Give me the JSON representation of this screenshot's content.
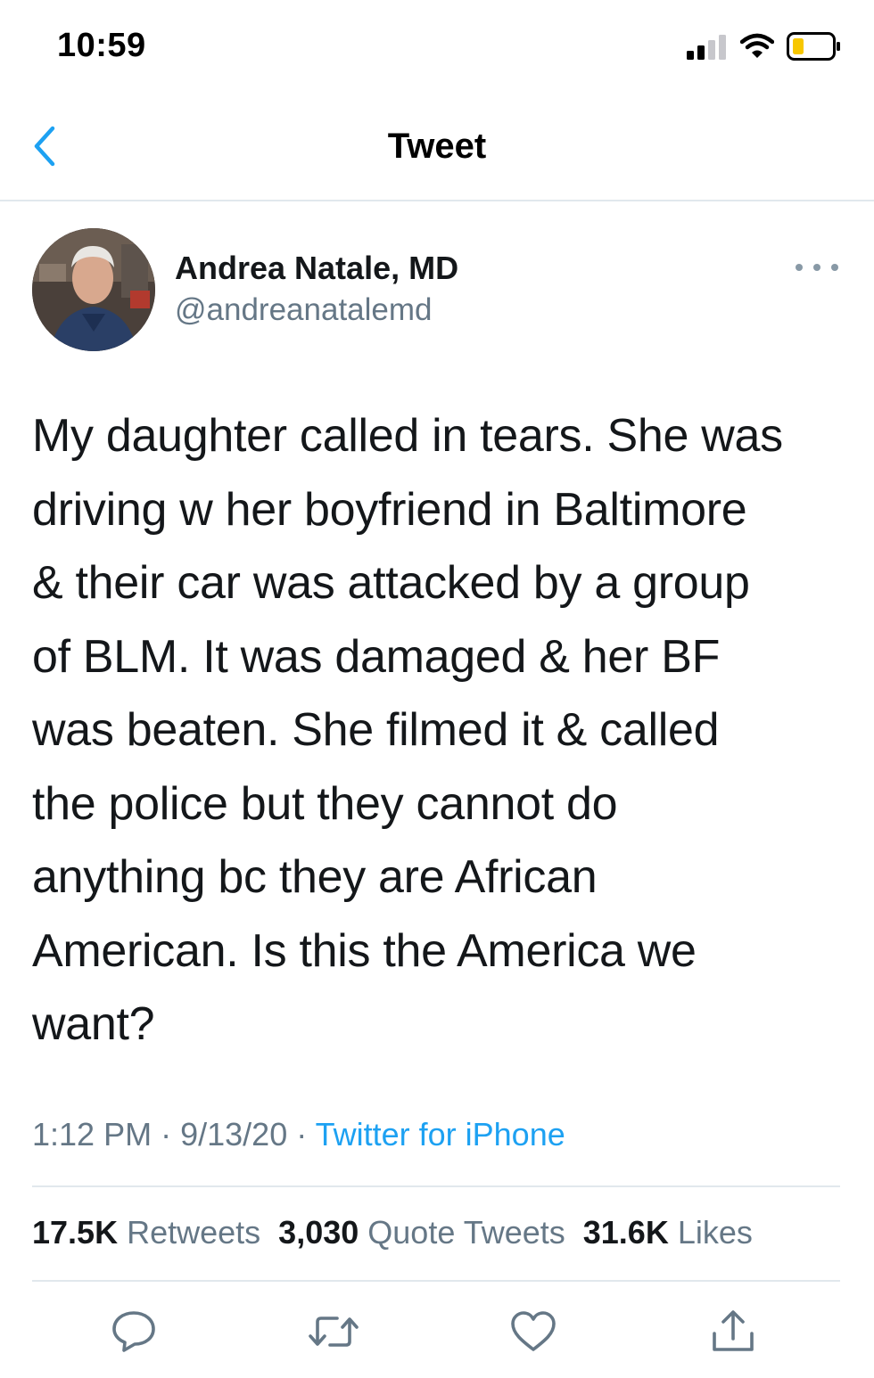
{
  "status_bar": {
    "time": "10:59"
  },
  "nav": {
    "title": "Tweet",
    "accent_color": "#1da1f2"
  },
  "author": {
    "name": "Andrea Natale, MD",
    "handle": "@andreanatalemd"
  },
  "tweet": {
    "text": "My daughter called in tears. She was driving w her boyfriend in Baltimore & their car was attacked by a group of BLM. It was damaged & her BF was beaten. She filmed it & called the police but they cannot do anything bc they are African American. Is this the America we want?",
    "lines": [
      "My daughter called in tears. She was",
      "driving w her boyfriend in Baltimore",
      "& their car was attacked by a group",
      "of BLM. It was damaged & her BF",
      "was beaten. She filmed it & called",
      "the police but they cannot do",
      "anything bc they are African",
      "American. Is this the America we",
      "want?"
    ],
    "time": "1:12 PM",
    "separator": "·",
    "date": "9/13/20",
    "source": "Twitter for iPhone"
  },
  "stats": {
    "retweets_count": "17.5K",
    "retweets_label": "Retweets",
    "quotes_count": "3,030",
    "quotes_label": "Quote Tweets",
    "likes_count": "31.6K",
    "likes_label": "Likes"
  },
  "actions": {
    "icons": [
      "reply-icon",
      "retweet-icon",
      "like-icon",
      "share-icon"
    ],
    "icon_color": "#657786"
  }
}
